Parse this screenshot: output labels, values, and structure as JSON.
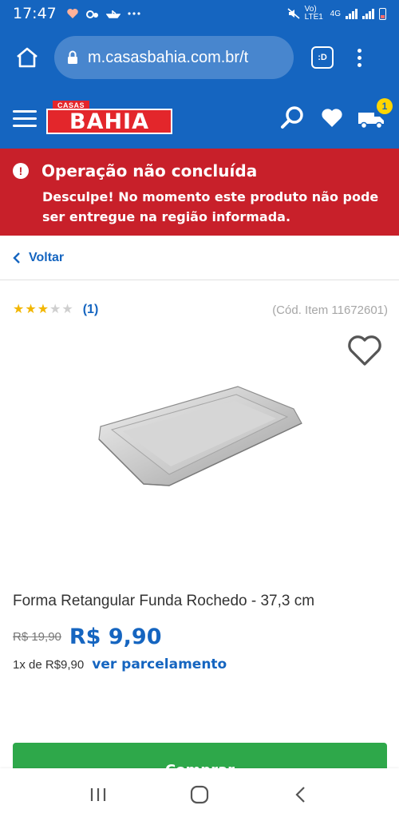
{
  "status_bar": {
    "time": "17:47",
    "network_label": "Vo) LTE1",
    "network_type": "4G"
  },
  "browser": {
    "url": "m.casasbahia.com.br/t",
    "tabs_label": ":D"
  },
  "site": {
    "logo_top": "CASAS",
    "logo_main": "BAHIA",
    "cart_count": "1",
    "brand_color": "#1565c0",
    "logo_color": "#e3262b"
  },
  "alert": {
    "icon": "!",
    "title": "Operação não concluída",
    "message": "Desculpe! No momento este produto não pode ser entregue na região informada.",
    "color": "#c8202a"
  },
  "back_link": {
    "label": "Voltar"
  },
  "product": {
    "rating": 3,
    "rating_max": 5,
    "rating_count": "(1)",
    "item_code": "(Cód. Item 11672601)",
    "title": "Forma Retangular Funda Rochedo - 37,3 cm",
    "old_price": "R$ 19,90",
    "price": "R$ 9,90",
    "installments": "1x de R$9,90",
    "installments_link": "ver parcelamento",
    "buy_label": "Comprar",
    "buy_color": "#2ea84a"
  }
}
